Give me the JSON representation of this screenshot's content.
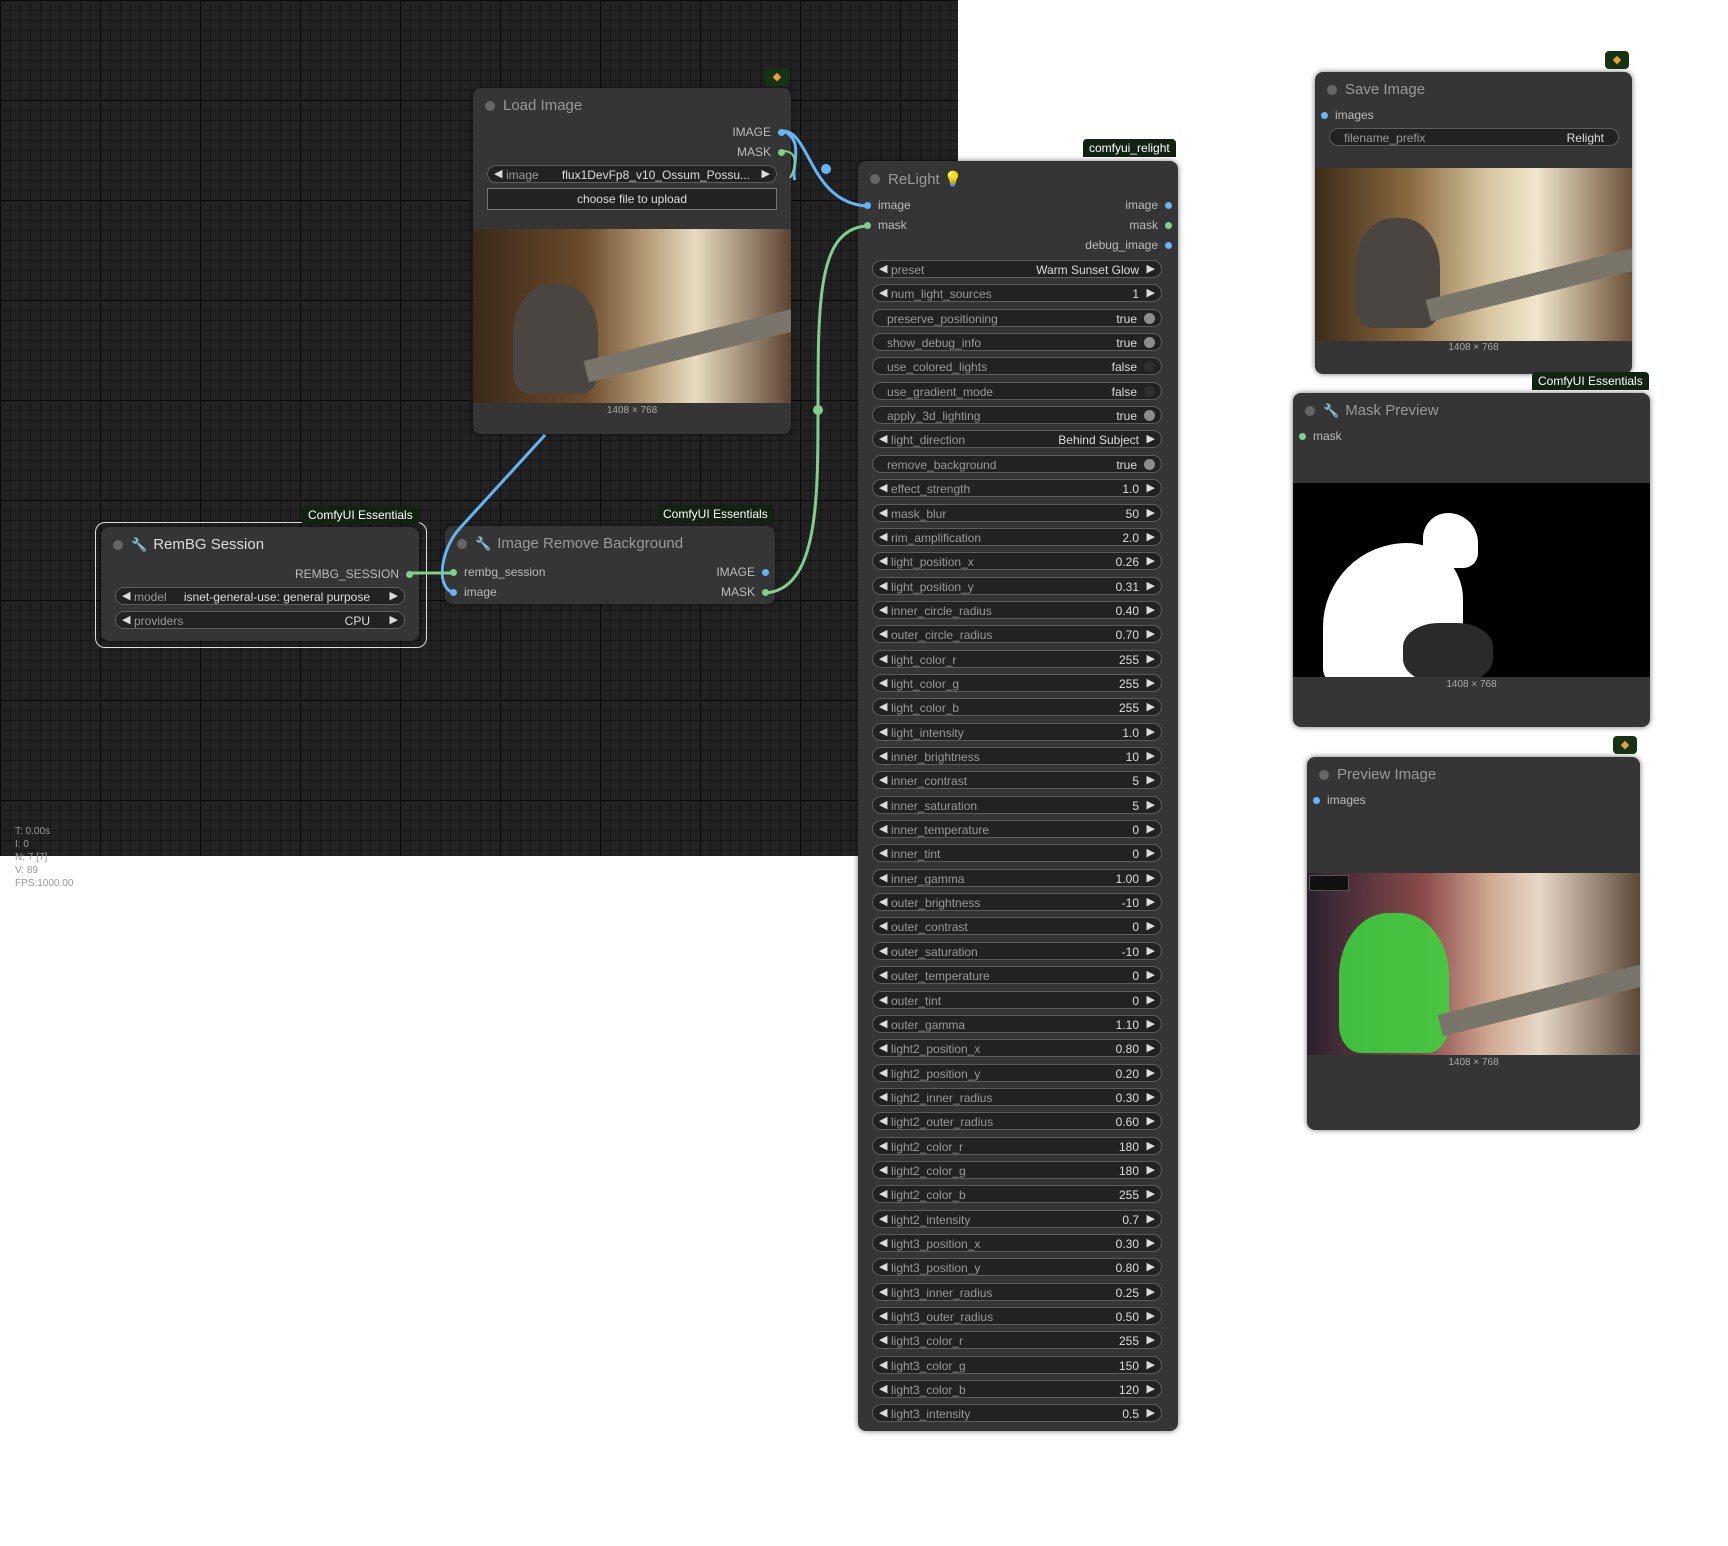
{
  "stats": {
    "t": "T: 0.00s",
    "i": "I: 0",
    "n": "N: 7 [7]",
    "v": "V: 89",
    "fps": "FPS:1000.00"
  },
  "icons": {
    "wrench": "wrench-icon",
    "fox": "fox-badge-icon",
    "bulb": "lightbulb-icon"
  },
  "load_image": {
    "title": "Load Image",
    "outputs": [
      "IMAGE",
      "MASK"
    ],
    "image_label": "image",
    "image_value": "flux1DevFp8_v10_Ossum_Possu...",
    "upload_label": "choose file to upload",
    "dims": "1408 × 768"
  },
  "rembg_session": {
    "badge": "ComfyUI Essentials",
    "title": "RemBG Session",
    "output": "REMBG_SESSION",
    "model_label": "model",
    "model_value": "isnet-general-use: general purpose",
    "providers_label": "providers",
    "providers_value": "CPU"
  },
  "remove_bg": {
    "badge": "ComfyUI Essentials",
    "title": "Image Remove Background",
    "inputs": [
      "rembg_session",
      "image"
    ],
    "outputs": [
      "IMAGE",
      "MASK"
    ]
  },
  "relight": {
    "badge": "comfyui_relight",
    "title": "ReLight",
    "inputs": [
      "image",
      "mask"
    ],
    "outputs": [
      "image",
      "mask",
      "debug_image"
    ],
    "widgets": [
      {
        "label": "preset",
        "value": "Warm Sunset Glow",
        "kind": "combo"
      },
      {
        "label": "num_light_sources",
        "value": "1",
        "kind": "number"
      },
      {
        "label": "preserve_positioning",
        "value": "true",
        "kind": "toggle"
      },
      {
        "label": "show_debug_info",
        "value": "true",
        "kind": "toggle"
      },
      {
        "label": "use_colored_lights",
        "value": "false",
        "kind": "toggle"
      },
      {
        "label": "use_gradient_mode",
        "value": "false",
        "kind": "toggle"
      },
      {
        "label": "apply_3d_lighting",
        "value": "true",
        "kind": "toggle"
      },
      {
        "label": "light_direction",
        "value": "Behind Subject",
        "kind": "combo"
      },
      {
        "label": "remove_background",
        "value": "true",
        "kind": "toggle"
      },
      {
        "label": "effect_strength",
        "value": "1.0",
        "kind": "number"
      },
      {
        "label": "mask_blur",
        "value": "50",
        "kind": "number"
      },
      {
        "label": "rim_amplification",
        "value": "2.0",
        "kind": "number"
      },
      {
        "label": "light_position_x",
        "value": "0.26",
        "kind": "number"
      },
      {
        "label": "light_position_y",
        "value": "0.31",
        "kind": "number"
      },
      {
        "label": "inner_circle_radius",
        "value": "0.40",
        "kind": "number"
      },
      {
        "label": "outer_circle_radius",
        "value": "0.70",
        "kind": "number"
      },
      {
        "label": "light_color_r",
        "value": "255",
        "kind": "number"
      },
      {
        "label": "light_color_g",
        "value": "255",
        "kind": "number"
      },
      {
        "label": "light_color_b",
        "value": "255",
        "kind": "number"
      },
      {
        "label": "light_intensity",
        "value": "1.0",
        "kind": "number"
      },
      {
        "label": "inner_brightness",
        "value": "10",
        "kind": "number"
      },
      {
        "label": "inner_contrast",
        "value": "5",
        "kind": "number"
      },
      {
        "label": "inner_saturation",
        "value": "5",
        "kind": "number"
      },
      {
        "label": "inner_temperature",
        "value": "0",
        "kind": "number"
      },
      {
        "label": "inner_tint",
        "value": "0",
        "kind": "number"
      },
      {
        "label": "inner_gamma",
        "value": "1.00",
        "kind": "number"
      },
      {
        "label": "outer_brightness",
        "value": "-10",
        "kind": "number"
      },
      {
        "label": "outer_contrast",
        "value": "0",
        "kind": "number"
      },
      {
        "label": "outer_saturation",
        "value": "-10",
        "kind": "number"
      },
      {
        "label": "outer_temperature",
        "value": "0",
        "kind": "number"
      },
      {
        "label": "outer_tint",
        "value": "0",
        "kind": "number"
      },
      {
        "label": "outer_gamma",
        "value": "1.10",
        "kind": "number"
      },
      {
        "label": "light2_position_x",
        "value": "0.80",
        "kind": "number"
      },
      {
        "label": "light2_position_y",
        "value": "0.20",
        "kind": "number"
      },
      {
        "label": "light2_inner_radius",
        "value": "0.30",
        "kind": "number"
      },
      {
        "label": "light2_outer_radius",
        "value": "0.60",
        "kind": "number"
      },
      {
        "label": "light2_color_r",
        "value": "180",
        "kind": "number"
      },
      {
        "label": "light2_color_g",
        "value": "180",
        "kind": "number"
      },
      {
        "label": "light2_color_b",
        "value": "255",
        "kind": "number"
      },
      {
        "label": "light2_intensity",
        "value": "0.7",
        "kind": "number"
      },
      {
        "label": "light3_position_x",
        "value": "0.30",
        "kind": "number"
      },
      {
        "label": "light3_position_y",
        "value": "0.80",
        "kind": "number"
      },
      {
        "label": "light3_inner_radius",
        "value": "0.25",
        "kind": "number"
      },
      {
        "label": "light3_outer_radius",
        "value": "0.50",
        "kind": "number"
      },
      {
        "label": "light3_color_r",
        "value": "255",
        "kind": "number"
      },
      {
        "label": "light3_color_g",
        "value": "150",
        "kind": "number"
      },
      {
        "label": "light3_color_b",
        "value": "120",
        "kind": "number"
      },
      {
        "label": "light3_intensity",
        "value": "0.5",
        "kind": "number"
      }
    ]
  },
  "save_image": {
    "title": "Save Image",
    "input": "images",
    "prefix_label": "filename_prefix",
    "prefix_value": "Relight",
    "dims": "1408 × 768"
  },
  "mask_preview": {
    "badge": "ComfyUI Essentials",
    "title": "Mask Preview",
    "input": "mask",
    "dims": "1408 × 768"
  },
  "preview_image": {
    "title": "Preview Image",
    "input": "images",
    "dims": "1408 × 768"
  },
  "colors": {
    "image_link": "#64b5f6",
    "mask_link": "#7ed08a",
    "node_bg": "#353535",
    "canvas_bg": "#222222"
  }
}
